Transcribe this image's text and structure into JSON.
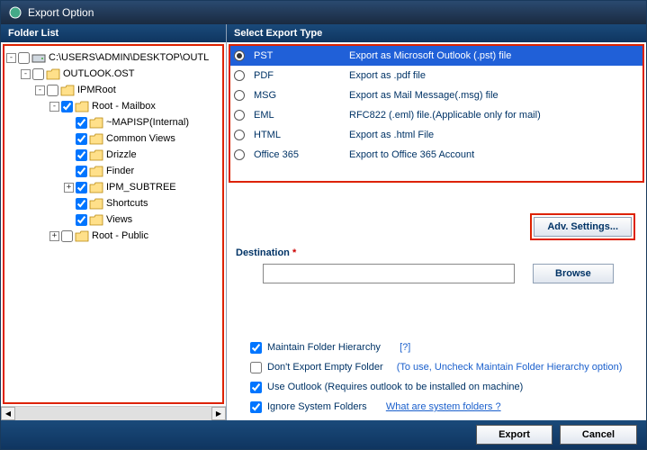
{
  "window": {
    "title": "Export Option"
  },
  "folderList": {
    "header": "Folder List",
    "items": [
      {
        "indent": 0,
        "expander": "-",
        "checked": false,
        "iconType": "drive",
        "label": "C:\\USERS\\ADMIN\\DESKTOP\\OUTL"
      },
      {
        "indent": 1,
        "expander": "-",
        "checked": false,
        "iconType": "folder",
        "label": "OUTLOOK.OST"
      },
      {
        "indent": 2,
        "expander": "-",
        "checked": false,
        "iconType": "folder",
        "label": "IPMRoot"
      },
      {
        "indent": 3,
        "expander": "-",
        "checked": true,
        "iconType": "folder",
        "label": "Root - Mailbox"
      },
      {
        "indent": 4,
        "expander": "",
        "checked": true,
        "iconType": "folder",
        "label": "~MAPISP(Internal)"
      },
      {
        "indent": 4,
        "expander": "",
        "checked": true,
        "iconType": "folder",
        "label": "Common Views"
      },
      {
        "indent": 4,
        "expander": "",
        "checked": true,
        "iconType": "folder",
        "label": "Drizzle"
      },
      {
        "indent": 4,
        "expander": "",
        "checked": true,
        "iconType": "folder",
        "label": "Finder"
      },
      {
        "indent": 4,
        "expander": "+",
        "checked": true,
        "iconType": "folder",
        "label": "IPM_SUBTREE"
      },
      {
        "indent": 4,
        "expander": "",
        "checked": true,
        "iconType": "folder",
        "label": "Shortcuts"
      },
      {
        "indent": 4,
        "expander": "",
        "checked": true,
        "iconType": "folder",
        "label": "Views"
      },
      {
        "indent": 3,
        "expander": "+",
        "checked": false,
        "iconType": "folder",
        "label": "Root - Public"
      }
    ]
  },
  "exportType": {
    "header": "Select Export Type",
    "options": [
      {
        "type": "PST",
        "desc": "Export as Microsoft Outlook (.pst) file",
        "selected": true
      },
      {
        "type": "PDF",
        "desc": "Export as .pdf file",
        "selected": false
      },
      {
        "type": "MSG",
        "desc": "Export as Mail Message(.msg) file",
        "selected": false
      },
      {
        "type": "EML",
        "desc": "RFC822 (.eml) file.(Applicable only for mail)",
        "selected": false
      },
      {
        "type": "HTML",
        "desc": "Export as .html File",
        "selected": false
      },
      {
        "type": "Office 365",
        "desc": "Export to Office 365 Account",
        "selected": false
      }
    ],
    "advButton": "Adv. Settings...",
    "destLabel": "Destination",
    "destReq": "*",
    "destValue": "",
    "browseButton": "Browse"
  },
  "options": {
    "maintain": {
      "checked": true,
      "label": "Maintain Folder Hierarchy",
      "help": "[?]"
    },
    "emptyFolder": {
      "checked": false,
      "label": "Don't Export Empty Folder",
      "hint": "(To use, Uncheck Maintain Folder Hierarchy option)"
    },
    "useOutlook": {
      "checked": true,
      "label": "Use Outlook (Requires outlook to be installed on machine)"
    },
    "ignoreSys": {
      "checked": true,
      "label": "Ignore System Folders",
      "link": "What are system folders ?"
    }
  },
  "footer": {
    "export": "Export",
    "cancel": "Cancel"
  }
}
